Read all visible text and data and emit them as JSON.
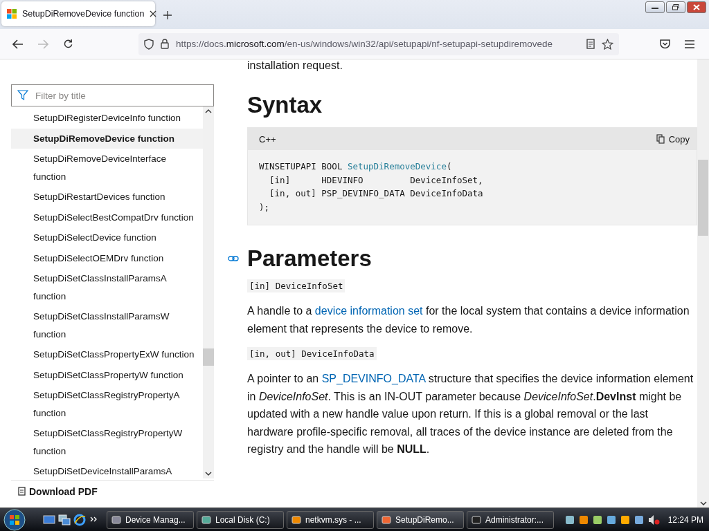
{
  "browser": {
    "tab": {
      "title": "SetupDiRemoveDevice function",
      "selected": true
    },
    "url": {
      "prefix": "https://docs.",
      "host": "microsoft.com",
      "path": "/en-us/windows/win32/api/setupapi/nf-setupapi-setupdiremovede"
    }
  },
  "sidebar": {
    "filter": {
      "placeholder": "Filter by title"
    },
    "items": [
      {
        "label": "SetupDiRegisterDeviceInfo function",
        "selected": false
      },
      {
        "label": "SetupDiRemoveDevice function",
        "selected": true
      },
      {
        "label": "SetupDiRemoveDeviceInterface function",
        "selected": false
      },
      {
        "label": "SetupDiRestartDevices function",
        "selected": false
      },
      {
        "label": "SetupDiSelectBestCompatDrv function",
        "selected": false
      },
      {
        "label": "SetupDiSelectDevice function",
        "selected": false
      },
      {
        "label": "SetupDiSelectOEMDrv function",
        "selected": false
      },
      {
        "label": "SetupDiSetClassInstallParamsA function",
        "selected": false
      },
      {
        "label": "SetupDiSetClassInstallParamsW function",
        "selected": false
      },
      {
        "label": "SetupDiSetClassPropertyExW function",
        "selected": false
      },
      {
        "label": "SetupDiSetClassPropertyW function",
        "selected": false
      },
      {
        "label": "SetupDiSetClassRegistryPropertyA function",
        "selected": false
      },
      {
        "label": "SetupDiSetClassRegistryPropertyW function",
        "selected": false
      },
      {
        "label": "SetupDiSetDeviceInstallParamsA",
        "selected": false
      }
    ],
    "download": "Download PDF"
  },
  "article": {
    "intro_cut": "installation request.",
    "syntax_heading": "Syntax",
    "code": {
      "language": "C++",
      "copy": "Copy",
      "lines": [
        [
          {
            "t": "WINSETUPAPI BOOL "
          },
          {
            "t": "SetupDiRemoveDevice",
            "kind": "link"
          },
          {
            "t": "("
          }
        ],
        [
          {
            "t": "  [in]      HDEVINFO         DeviceInfoSet,"
          }
        ],
        [
          {
            "t": "  [in, out] PSP_DEVINFO_DATA DeviceInfoData"
          }
        ],
        [
          {
            "t": ");"
          }
        ]
      ]
    },
    "parameters_heading": "Parameters",
    "params": [
      {
        "name": "[in] DeviceInfoSet",
        "description": [
          {
            "t": "A handle to a "
          },
          {
            "t": "device information set",
            "kind": "link"
          },
          {
            "t": " for the local system that contains a device information element that represents the device to remove."
          }
        ]
      },
      {
        "name": "[in, out] DeviceInfoData",
        "description": [
          {
            "t": "A pointer to an "
          },
          {
            "t": "SP_DEVINFO_DATA",
            "kind": "link"
          },
          {
            "t": " structure that specifies the device information element in *DeviceInfoSet*. This is an IN-OUT parameter because *DeviceInfoSet*.**DevInst** might be updated with a new handle value upon return. If this is a global removal or the last hardware profile-specific removal, all traces of the device instance are deleted from the registry and the handle will be **NULL**."
          }
        ]
      }
    ]
  },
  "taskbar": {
    "items": [
      {
        "label": "Device Manag...",
        "selected": false
      },
      {
        "label": "Local Disk (C:)",
        "selected": false
      },
      {
        "label": "netkvm.sys - ...",
        "selected": false
      },
      {
        "label": "SetupDiRemo...",
        "selected": true
      },
      {
        "label": "Administrator:...",
        "selected": false
      }
    ],
    "clock": "12:24 PM"
  }
}
